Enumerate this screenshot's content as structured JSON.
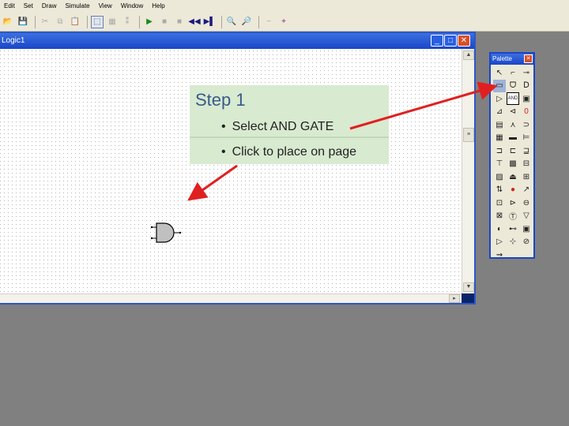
{
  "menu": [
    "Edit",
    "Set",
    "Draw",
    "Simulate",
    "View",
    "Window",
    "Help"
  ],
  "toolbar": {
    "buttons": [
      {
        "name": "open-icon",
        "glyph": "📂"
      },
      {
        "name": "save-icon",
        "glyph": "💾"
      },
      {
        "name": "cut-icon",
        "glyph": "✂"
      },
      {
        "name": "copy-icon",
        "glyph": "⧉"
      },
      {
        "name": "paste-icon",
        "glyph": "📋"
      },
      {
        "name": "select-tool-icon",
        "glyph": "⬚"
      },
      {
        "name": "tool-b-icon",
        "glyph": "▦"
      },
      {
        "name": "tool-c-icon",
        "glyph": "⁑"
      },
      {
        "name": "play-icon",
        "glyph": "▶"
      },
      {
        "name": "stop-icon",
        "glyph": "■"
      },
      {
        "name": "pause-icon",
        "glyph": "■"
      },
      {
        "name": "rewind-icon",
        "glyph": "◀◀"
      },
      {
        "name": "step-icon",
        "glyph": "▶▌"
      },
      {
        "name": "zoom-in-icon",
        "glyph": "🔍"
      },
      {
        "name": "zoom-out-icon",
        "glyph": "🔎"
      },
      {
        "name": "minus-icon",
        "glyph": "−"
      },
      {
        "name": "plus-icon",
        "glyph": "+"
      }
    ]
  },
  "window": {
    "title": "Logic1",
    "minimize": "_",
    "maximize": "□",
    "close": "✕"
  },
  "callout": {
    "title": "Step 1",
    "bullet": "•",
    "bullets": [
      "Select AND GATE",
      "Click to place on page"
    ]
  },
  "palette": {
    "title": "Palette",
    "close": "✕",
    "items": [
      "↖",
      "⌐",
      "⊸",
      "▭",
      "ᗜ",
      "ᗞ",
      "▷",
      "AND",
      "▣",
      "⊿",
      "⊲",
      "0",
      "▤",
      "⋏",
      "⊃",
      "▦",
      "▬",
      "⊨",
      "⊐",
      "⊏",
      "⊒",
      "⊤",
      "▩",
      "⊟",
      "▨",
      "⏏",
      "⊞",
      "⇅",
      "●",
      "↗",
      "⊡",
      "⊳",
      "⊖",
      "⊠",
      "Ⓣ",
      "▽",
      "◐",
      "⊷",
      "▣",
      "▷",
      "⊹",
      "⊘",
      "⇝",
      "",
      ""
    ]
  },
  "colors": {
    "accent": "#1a46c8",
    "callout_bg": "#d8ead0",
    "arrow": "#e02020"
  }
}
